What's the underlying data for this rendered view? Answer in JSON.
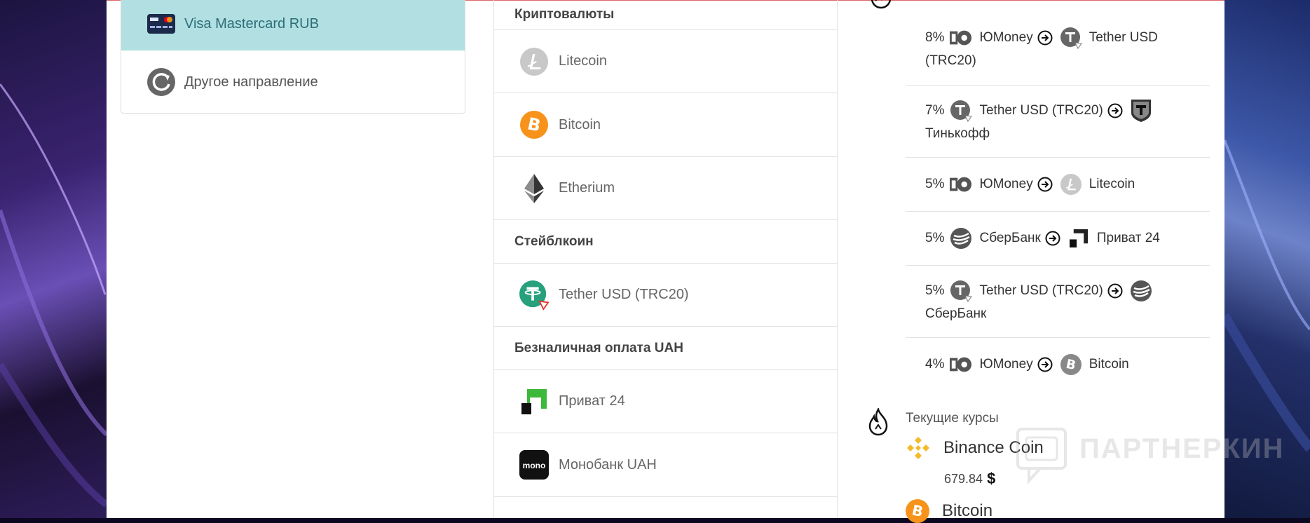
{
  "left_panel": {
    "active_item": {
      "label": "Visa Mastercard RUB",
      "icon": "visa-mastercard-card-icon"
    },
    "other_item": {
      "label": "Другое направление",
      "icon": "refresh-icon"
    }
  },
  "middle": {
    "sections": [
      {
        "header": "Криптовалюты",
        "items": [
          {
            "label": "Litecoin",
            "icon": "litecoin-icon"
          },
          {
            "label": "Bitcoin",
            "icon": "bitcoin-icon"
          },
          {
            "label": "Etherium",
            "icon": "ethereum-icon"
          }
        ]
      },
      {
        "header": "Стейблкоин",
        "items": [
          {
            "label": "Tether USD (TRC20)",
            "icon": "tether-icon"
          }
        ]
      },
      {
        "header": "Безналичная оплата UAH",
        "items": [
          {
            "label": "Приват 24",
            "icon": "privat24-icon"
          },
          {
            "label": "Монобанк UAH",
            "icon": "monobank-icon"
          }
        ]
      }
    ]
  },
  "popular": {
    "rows": [
      {
        "percent": "8%",
        "from": "ЮMoney",
        "to": "Tether USD",
        "to_line2": "(TRC20)"
      },
      {
        "percent": "7%",
        "from": "Tether USD (TRC20)",
        "to": "",
        "to_line2": "Тинькофф"
      },
      {
        "percent": "5%",
        "from": "ЮMoney",
        "to": "Litecoin",
        "to_line2": ""
      },
      {
        "percent": "5%",
        "from": "СберБанк",
        "to": "Приват 24",
        "to_line2": ""
      },
      {
        "percent": "5%",
        "from": "Tether USD (TRC20)",
        "to": "",
        "to_line2": "СберБанк"
      },
      {
        "percent": "4%",
        "from": "ЮMoney",
        "to": "Bitcoin",
        "to_line2": ""
      }
    ]
  },
  "rates": {
    "title": "Текущие курсы",
    "items": [
      {
        "name": "Binance Coin",
        "value": "679.84",
        "currency": "$",
        "icon": "binance-coin-icon"
      },
      {
        "name": "Bitcoin",
        "icon": "bitcoin-icon"
      }
    ]
  },
  "watermark": {
    "text": "ПАРТНЕРКИН"
  },
  "colors": {
    "active_bg": "#b1dfe2",
    "bitcoin": "#f7931a",
    "tether": "#26a17b",
    "privat": "#3db83a",
    "binance": "#f3ba2f"
  }
}
